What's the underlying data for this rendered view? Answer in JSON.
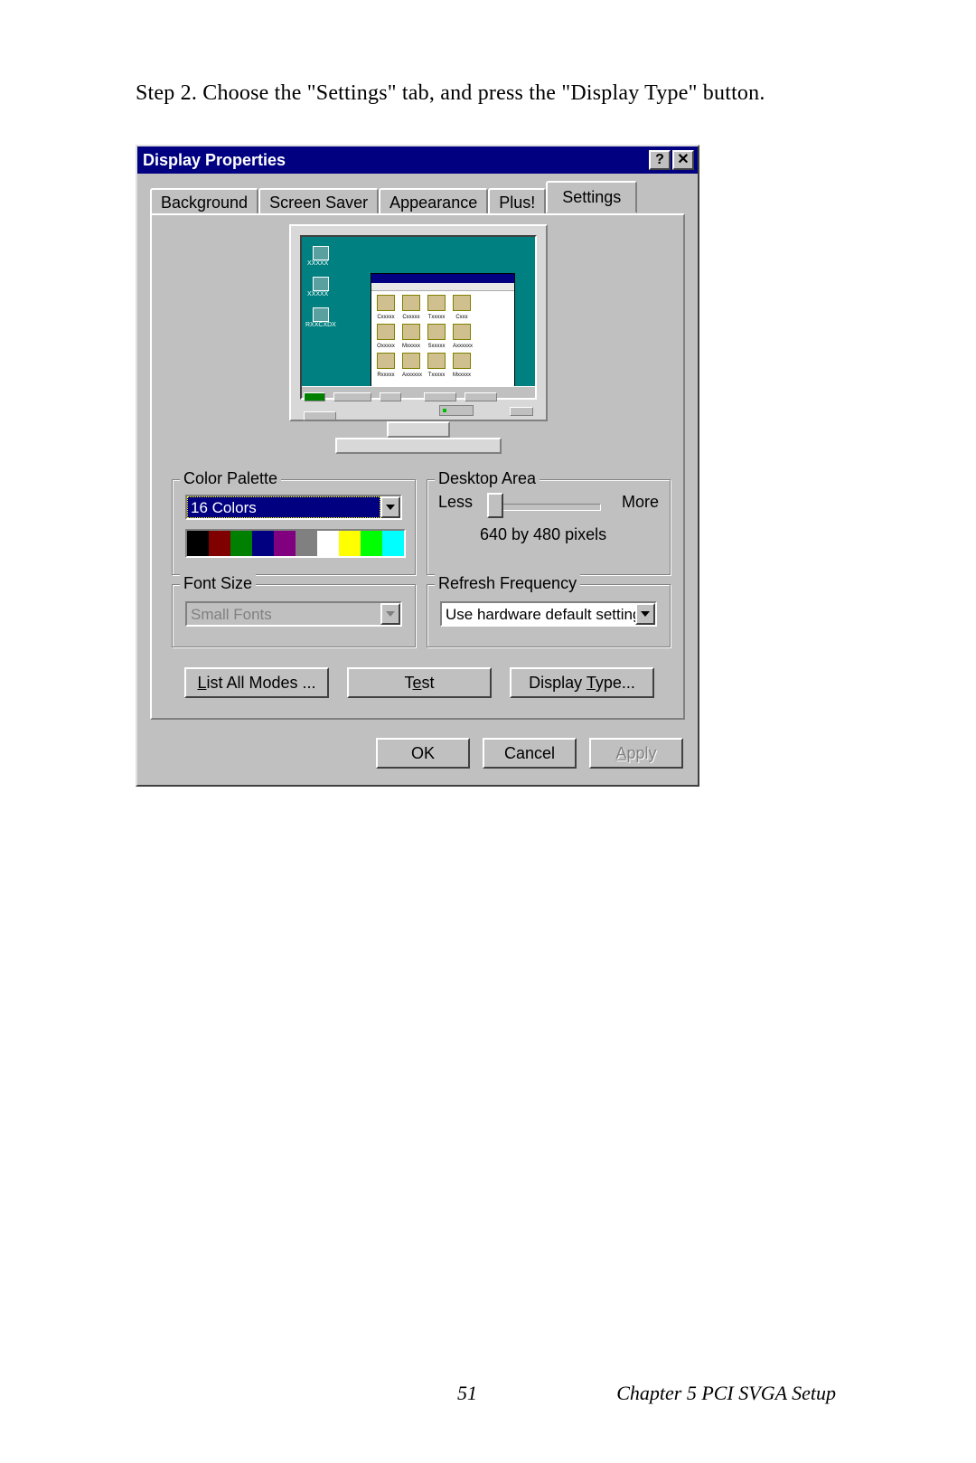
{
  "step_text": "Step 2.  Choose the \"Settings\" tab, and press the \"Display Type\" button.",
  "footer": {
    "page_number": "51",
    "chapter": "Chapter 5  PCI SVGA Setup"
  },
  "dialog": {
    "title": "Display Properties",
    "help_btn": "?",
    "close_btn": "✕",
    "tabs": {
      "background": "Background",
      "screensaver": "Screen Saver",
      "appearance": "Appearance",
      "plus": "Plus!",
      "settings": "Settings"
    },
    "groups": {
      "color_palette": {
        "legend": "Color Palette",
        "value": "16 Colors"
      },
      "desktop_area": {
        "legend": "Desktop Area",
        "less": "Less",
        "more": "More",
        "resolution": "640 by 480 pixels"
      },
      "font_size": {
        "legend": "Font Size",
        "value": "Small Fonts"
      },
      "refresh": {
        "legend": "Refresh Frequency",
        "value": "Use hardware default setting"
      }
    },
    "color_swatches": [
      "#000000",
      "#800000",
      "#008000",
      "#000080",
      "#800080",
      "#808080",
      "#ffffff",
      "#ffff00",
      "#00ff00",
      "#00ffff"
    ],
    "buttons": {
      "list_all_modes": "List All Modes ...",
      "test": "Test",
      "display_type": "Display Type...",
      "ok": "OK",
      "cancel": "Cancel",
      "apply": "Apply"
    }
  }
}
